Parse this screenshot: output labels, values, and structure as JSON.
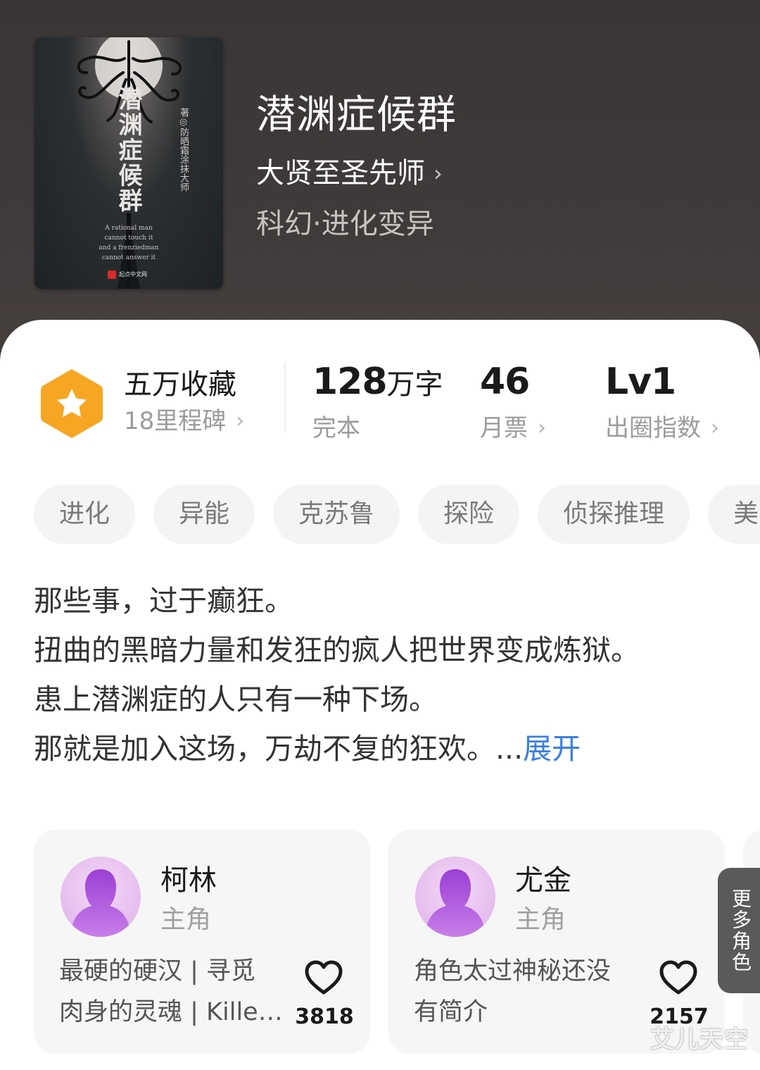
{
  "book": {
    "cover": {
      "title": "潜渊症候群",
      "author_line": "著◎防晒霜涂抹大师",
      "tagline": "A rational man\ncannot touch it\nand a frenziedman\ncannot answer it",
      "publisher": "起点中文网"
    },
    "title": "潜渊症候群",
    "author": "大贤至圣先师",
    "genre": "科幻·进化变异"
  },
  "stats": {
    "collection": {
      "label": "五万收藏",
      "sub": "18里程碑"
    },
    "words": {
      "num": "128",
      "unit": "万字",
      "sub": "完本"
    },
    "monthly_votes": {
      "value": "46",
      "label": "月票"
    },
    "breakout": {
      "value": "Lv1",
      "label": "出圈指数"
    }
  },
  "tags": [
    "进化",
    "异能",
    "克苏鲁",
    "探险",
    "侦探推理",
    "美漫"
  ],
  "synopsis": {
    "lines": [
      "那些事，过于癫狂。",
      "扭曲的黑暗力量和发狂的疯人把世界变成炼狱。",
      "患上潜渊症的人只有一种下场。",
      "那就是加入这场，万劫不复的狂欢。..."
    ],
    "expand": "展开"
  },
  "roles": [
    {
      "name": "柯林",
      "type": "主角",
      "desc_lines": [
        "最硬的硬汉 | 寻觅",
        "肉身的灵魂 | Killer..."
      ],
      "likes": "3818"
    },
    {
      "name": "尤金",
      "type": "主角",
      "desc_lines": [
        "角色太过神秘还没",
        "有简介"
      ],
      "likes": "2157"
    }
  ],
  "more_roles": "更多角色",
  "watermark": "艾儿天空",
  "icons": {
    "badge": "star-hexagon-icon",
    "chevron": "chevron-right-icon",
    "like": "heart-outline-icon",
    "avatar": "person-silhouette-icon"
  },
  "colors": {
    "header_bg": "#3d3838",
    "badge_orange": "#f6a623",
    "expand_blue": "#3a7ee0",
    "tag_bg": "#f4f4f4",
    "card_bg": "#f6f6f6",
    "avatar_purple": "#b35ce0"
  }
}
